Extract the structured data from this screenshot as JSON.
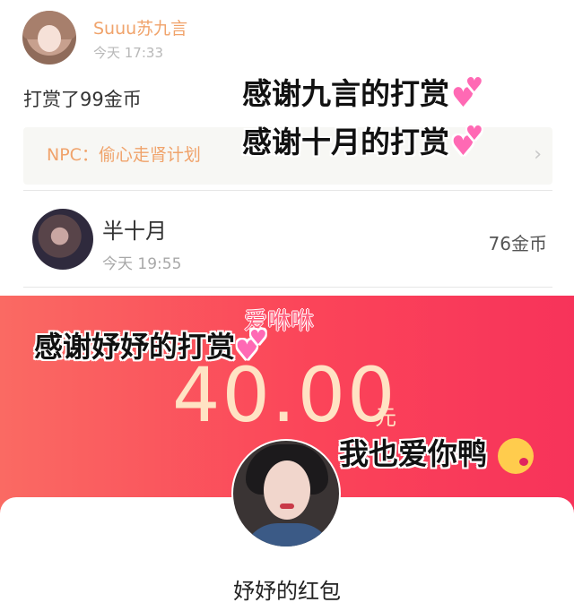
{
  "tip": {
    "user_name": "Suuu苏九言",
    "time": "今天 17:33",
    "message": "打赏了99金币",
    "npc_text": "NPC：偷心走肾计划",
    "chevron": "›"
  },
  "reward": {
    "user_name": "半十月",
    "time": "今天 19:55",
    "amount": "76金币"
  },
  "red_packet": {
    "amount": "40.00",
    "unit": "元",
    "title": "妤妤的红包"
  },
  "overlays": {
    "thanks_jiuyan": "感谢九言的打赏",
    "thanks_shiyue": "感谢十月的打赏",
    "kawaii_text": "爱咻咻",
    "thanks_yuyu": "感谢妤妤的打赏",
    "love_you": "我也爱你鸭"
  },
  "icons": [
    "heart-icon",
    "wink-kiss-emoji-icon",
    "chevron-right-icon"
  ],
  "colors": {
    "orange_accent": "#f0a36b",
    "red_panel": "#fb4459",
    "amount_text": "#ffe3c4",
    "heart_pink": "#ff69b4"
  }
}
